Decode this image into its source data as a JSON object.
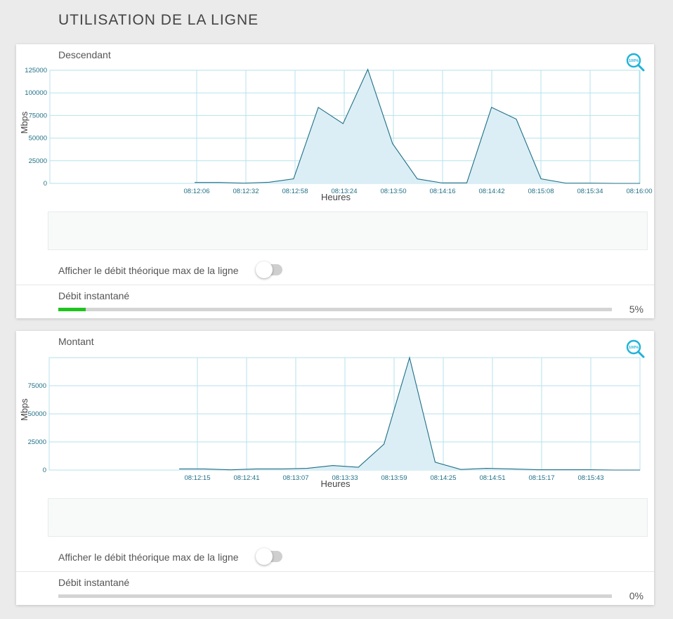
{
  "page": {
    "title": "UTILISATION DE LA LIGNE"
  },
  "toggle_label": "Afficher le débit théorique max de la ligne",
  "rate_label": "Débit instantané",
  "zoom_icon_text": "100%",
  "colors": {
    "line": "#1f6f86",
    "fill": "#dbeef5",
    "grid": "#b5e2ec",
    "tick": "#1f6f86",
    "accent": "#1ec41e",
    "zoom": "#1fb3d8"
  },
  "downstream": {
    "label": "Descendant",
    "rate_percent": 5,
    "rate_text": "5%",
    "toggle_on": false
  },
  "upstream": {
    "label": "Montant",
    "rate_percent": 0,
    "rate_text": "0%",
    "toggle_on": false
  },
  "chart_data": [
    {
      "type": "area",
      "title": "Descendant",
      "xlabel": "Heures",
      "ylabel": "Mbps",
      "ylim": [
        0,
        125000
      ],
      "yticks": [
        0,
        25000,
        50000,
        75000,
        100000,
        125000
      ],
      "xticks": [
        "08:12:06",
        "08:12:32",
        "08:12:58",
        "08:13:24",
        "08:13:50",
        "08:14:16",
        "08:14:42",
        "08:15:08",
        "08:15:34",
        "08:16:00"
      ],
      "xrange_seconds": [
        0,
        234
      ],
      "x_seconds": [
        0,
        13,
        26,
        39,
        52,
        65,
        78,
        91,
        104,
        117,
        130,
        143,
        156,
        169,
        182,
        195,
        208,
        221,
        234
      ],
      "x": [
        "08:12:06",
        "08:12:19",
        "08:12:32",
        "08:12:45",
        "08:12:58",
        "08:13:11",
        "08:13:24",
        "08:13:37",
        "08:13:50",
        "08:14:03",
        "08:14:16",
        "08:14:29",
        "08:14:42",
        "08:14:55",
        "08:15:08",
        "08:15:21",
        "08:15:34",
        "08:15:47",
        "08:16:00"
      ],
      "grid": true,
      "series": [
        {
          "values": [
            1000,
            1000,
            300,
            1200,
            5000,
            84000,
            66000,
            126000,
            44000,
            5000,
            500,
            500,
            84000,
            71000,
            5000,
            300,
            300,
            0,
            0
          ]
        }
      ]
    },
    {
      "type": "area",
      "title": "Montant",
      "xlabel": "Heures",
      "ylabel": "Mbps",
      "ylim": [
        0,
        100000
      ],
      "yticks": [
        0,
        25000,
        50000,
        75000
      ],
      "xticks": [
        "08:12:15",
        "08:12:41",
        "08:13:07",
        "08:13:33",
        "08:13:59",
        "08:14:25",
        "08:14:51",
        "08:15:17",
        "08:15:43"
      ],
      "xrange_seconds": [
        0,
        234
      ],
      "x_seconds": [
        0,
        13,
        26,
        39,
        52,
        65,
        78,
        91,
        104,
        117,
        130,
        143,
        156,
        169,
        182,
        195,
        208,
        221,
        234
      ],
      "x": [
        "08:12:10",
        "08:12:23",
        "08:12:36",
        "08:12:49",
        "08:13:02",
        "08:13:15",
        "08:13:28",
        "08:13:41",
        "08:13:54",
        "08:14:07",
        "08:14:20",
        "08:14:33",
        "08:14:46",
        "08:14:59",
        "08:15:12",
        "08:15:25",
        "08:15:38",
        "08:15:51",
        "08:16:04"
      ],
      "grid": true,
      "series": [
        {
          "values": [
            1000,
            1000,
            200,
            1000,
            1000,
            1500,
            4000,
            2500,
            23000,
            100000,
            7000,
            500,
            1500,
            1000,
            300,
            300,
            300,
            0,
            0
          ]
        }
      ]
    }
  ]
}
